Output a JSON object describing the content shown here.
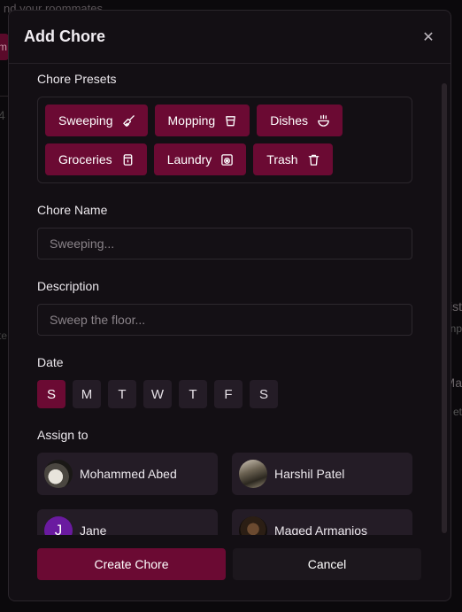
{
  "background": {
    "top_text": "nd your roommates",
    "chip_text": "m",
    "left_text_1": "4",
    "left_text_2": "te",
    "right_text_1": "ist",
    "right_text_2": "np",
    "right_text_3": "Ma",
    "right_text_4": "et"
  },
  "modal": {
    "title": "Add Chore",
    "close_icon": "close-icon"
  },
  "presets": {
    "label": "Chore Presets",
    "items": [
      {
        "label": "Sweeping",
        "icon": "broom-icon"
      },
      {
        "label": "Mopping",
        "icon": "bucket-icon"
      },
      {
        "label": "Dishes",
        "icon": "bowl-icon"
      },
      {
        "label": "Groceries",
        "icon": "jar-icon"
      },
      {
        "label": "Laundry",
        "icon": "washing-machine-icon"
      },
      {
        "label": "Trash",
        "icon": "trash-icon"
      }
    ]
  },
  "chore_name": {
    "label": "Chore Name",
    "placeholder": "Sweeping...",
    "value": ""
  },
  "description": {
    "label": "Description",
    "placeholder": "Sweep the floor...",
    "value": ""
  },
  "date": {
    "label": "Date",
    "days": [
      "S",
      "M",
      "T",
      "W",
      "T",
      "F",
      "S"
    ],
    "selected_index": 0
  },
  "assign": {
    "label": "Assign to",
    "people": [
      {
        "name": "Mohammed Abed",
        "avatar": "photo"
      },
      {
        "name": "Harshil Patel",
        "avatar": "photo"
      },
      {
        "name": "Jane",
        "avatar_initial": "J"
      },
      {
        "name": "Maged Armanios",
        "avatar": "photo"
      }
    ]
  },
  "footer": {
    "create_label": "Create Chore",
    "cancel_label": "Cancel"
  },
  "colors": {
    "accent": "#6b0a33",
    "background": "#130f14",
    "card": "#241c26"
  }
}
